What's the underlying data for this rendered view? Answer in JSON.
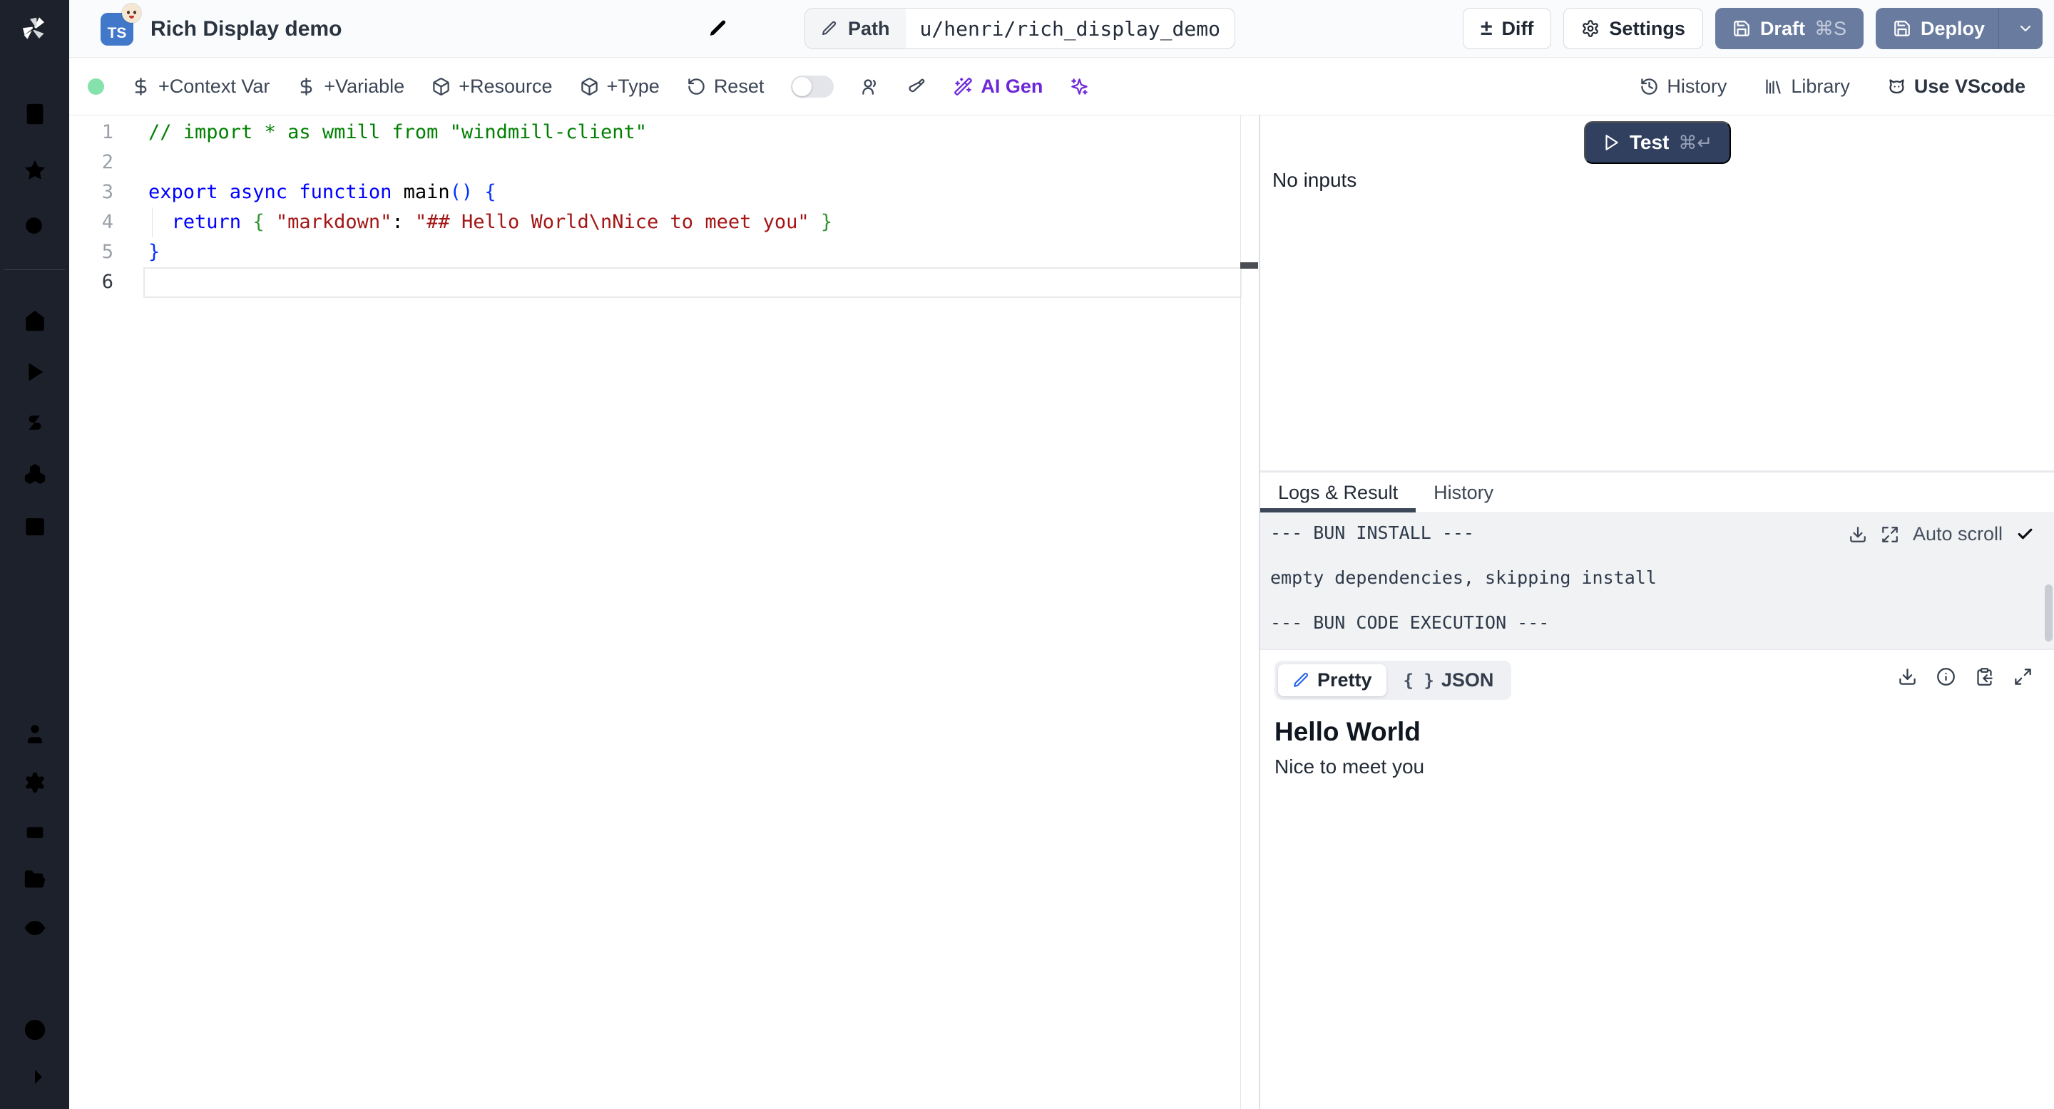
{
  "topbar": {
    "language_badge": "TS",
    "title": "Rich Display demo",
    "path_label": "Path",
    "path_value": "u/henri/rich_display_demo",
    "diff_icon": "±",
    "diff_label": "Diff",
    "settings_label": "Settings",
    "draft_label": "Draft",
    "draft_shortcut": "⌘S",
    "deploy_label": "Deploy"
  },
  "toolbar": {
    "add_context_var": "+Context Var",
    "add_variable": "+Variable",
    "add_resource": "+Resource",
    "add_type": "+Type",
    "reset": "Reset",
    "ai_gen": "AI Gen",
    "history": "History",
    "library": "Library",
    "use_vscode": "Use VScode"
  },
  "editor": {
    "lines": [
      {
        "n": "1",
        "segments": [
          {
            "text": "// import * as wmill from \"windmill-client\"",
            "type": "comment"
          }
        ]
      },
      {
        "n": "2",
        "segments": []
      },
      {
        "n": "3",
        "segments": [
          {
            "text": "export async function ",
            "type": "kw"
          },
          {
            "text": "main",
            "type": "plain"
          },
          {
            "text": "() {",
            "type": "b1"
          }
        ]
      },
      {
        "n": "4",
        "segments": [
          {
            "text": "  ",
            "type": "plain"
          },
          {
            "text": "return",
            "type": "kw"
          },
          {
            "text": " ",
            "type": "plain"
          },
          {
            "text": "{",
            "type": "b2"
          },
          {
            "text": " ",
            "type": "plain"
          },
          {
            "text": "\"markdown\"",
            "type": "str"
          },
          {
            "text": ": ",
            "type": "plain"
          },
          {
            "text": "\"## Hello World\\nNice to meet you\"",
            "type": "str"
          },
          {
            "text": " ",
            "type": "plain"
          },
          {
            "text": "}",
            "type": "b2"
          }
        ]
      },
      {
        "n": "5",
        "segments": [
          {
            "text": "}",
            "type": "b1"
          }
        ]
      },
      {
        "n": "6",
        "segments": []
      }
    ]
  },
  "run_panel": {
    "test_label": "Test",
    "test_shortcut": "⌘↵",
    "no_inputs": "No inputs",
    "tab_logs": "Logs & Result",
    "tab_history": "History",
    "auto_scroll_label": "Auto scroll",
    "logs_text": "--- BUN INSTALL ---\n\nempty dependencies, skipping install\n\n--- BUN CODE EXECUTION ---",
    "result": {
      "pretty_label": "Pretty",
      "json_icon": "{ }",
      "json_label": "JSON",
      "heading": "Hello World",
      "body": "Nice to meet you"
    }
  },
  "colors": {
    "accent_button": "#697ca0",
    "test_button": "#32405f",
    "ai_purple": "#6d28d9",
    "status_green": "#86e2ab",
    "sidebar_bg": "#1d212b",
    "ts_badge_blue": "#4278c9"
  }
}
